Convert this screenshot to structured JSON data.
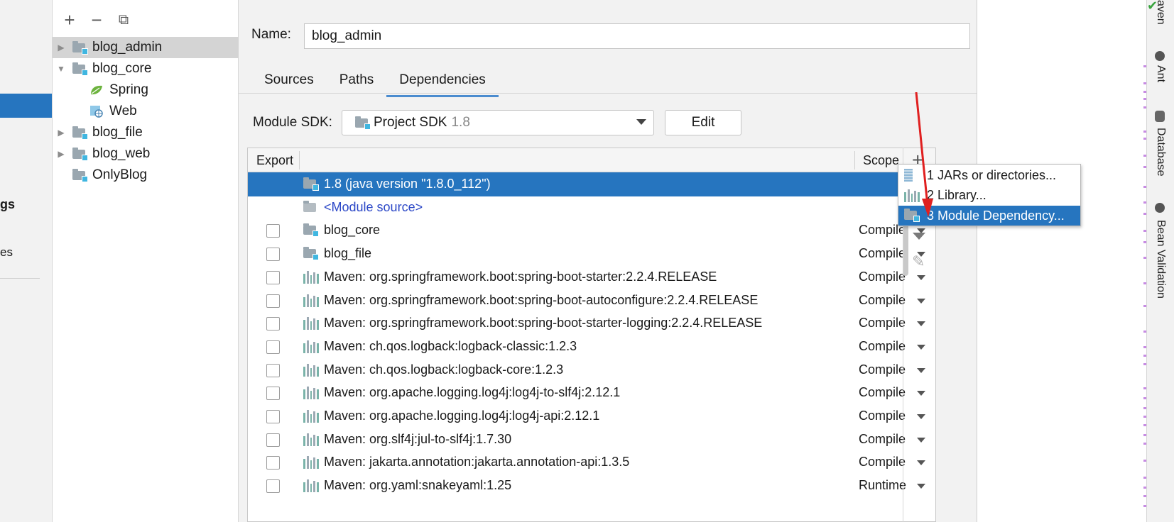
{
  "left_strip": {
    "partial_text_1": "gs",
    "partial_text_2": "es"
  },
  "tree": {
    "toolbar": {
      "add": "+",
      "remove": "−",
      "copy": "⧉"
    },
    "items": [
      {
        "label": "blog_admin",
        "expand": "collapsed",
        "selected": true,
        "icon": "module-folder-icon"
      },
      {
        "label": "blog_core",
        "expand": "expanded",
        "selected": false,
        "icon": "module-folder-icon"
      },
      {
        "label": "Spring",
        "expand": "none",
        "selected": false,
        "icon": "spring-leaf-icon"
      },
      {
        "label": "Web",
        "expand": "none",
        "selected": false,
        "icon": "web-icon"
      },
      {
        "label": "blog_file",
        "expand": "collapsed",
        "selected": false,
        "icon": "module-folder-icon"
      },
      {
        "label": "blog_web",
        "expand": "collapsed",
        "selected": false,
        "icon": "module-folder-icon"
      },
      {
        "label": "OnlyBlog",
        "expand": "none",
        "selected": false,
        "icon": "module-folder-icon"
      }
    ]
  },
  "main": {
    "name_label": "Name:",
    "name_value": "blog_admin",
    "tabs": [
      {
        "label": "Sources",
        "active": false
      },
      {
        "label": "Paths",
        "active": false
      },
      {
        "label": "Dependencies",
        "active": true
      }
    ],
    "sdk_label": "Module SDK:",
    "sdk_value": "Project SDK",
    "sdk_version": "1.8",
    "edit_button": "Edit"
  },
  "dependencies": {
    "header_export": "Export",
    "header_scope": "Scope",
    "rows": [
      {
        "label": "1.8 (java version \"1.8.0_112\")",
        "icon": "jdk-folder-icon",
        "checkbox": false,
        "scope": "",
        "selected": true
      },
      {
        "label": "<Module source>",
        "icon": "module-source-icon",
        "checkbox": false,
        "scope": "",
        "selected": false
      },
      {
        "label": "blog_core",
        "icon": "module-folder-icon",
        "checkbox": true,
        "scope": "Compile",
        "selected": false
      },
      {
        "label": "blog_file",
        "icon": "module-folder-icon",
        "checkbox": true,
        "scope": "Compile",
        "selected": false
      },
      {
        "label": "Maven: org.springframework.boot:spring-boot-starter:2.2.4.RELEASE",
        "icon": "library-icon",
        "checkbox": true,
        "scope": "Compile",
        "selected": false
      },
      {
        "label": "Maven: org.springframework.boot:spring-boot-autoconfigure:2.2.4.RELEASE",
        "icon": "library-icon",
        "checkbox": true,
        "scope": "Compile",
        "selected": false
      },
      {
        "label": "Maven: org.springframework.boot:spring-boot-starter-logging:2.2.4.RELEASE",
        "icon": "library-icon",
        "checkbox": true,
        "scope": "Compile",
        "selected": false
      },
      {
        "label": "Maven: ch.qos.logback:logback-classic:1.2.3",
        "icon": "library-icon",
        "checkbox": true,
        "scope": "Compile",
        "selected": false
      },
      {
        "label": "Maven: ch.qos.logback:logback-core:1.2.3",
        "icon": "library-icon",
        "checkbox": true,
        "scope": "Compile",
        "selected": false
      },
      {
        "label": "Maven: org.apache.logging.log4j:log4j-to-slf4j:2.12.1",
        "icon": "library-icon",
        "checkbox": true,
        "scope": "Compile",
        "selected": false
      },
      {
        "label": "Maven: org.apache.logging.log4j:log4j-api:2.12.1",
        "icon": "library-icon",
        "checkbox": true,
        "scope": "Compile",
        "selected": false
      },
      {
        "label": "Maven: org.slf4j:jul-to-slf4j:1.7.30",
        "icon": "library-icon",
        "checkbox": true,
        "scope": "Compile",
        "selected": false
      },
      {
        "label": "Maven: jakarta.annotation:jakarta.annotation-api:1.3.5",
        "icon": "library-icon",
        "checkbox": true,
        "scope": "Compile",
        "selected": false
      },
      {
        "label": "Maven: org.yaml:snakeyaml:1.25",
        "icon": "library-icon",
        "checkbox": true,
        "scope": "Runtime",
        "selected": false
      }
    ]
  },
  "table_tools": {
    "add": "+",
    "edit": "✎"
  },
  "popup_menu": {
    "items": [
      {
        "label": "1  JARs or directories...",
        "icon": "jar-icon",
        "selected": false
      },
      {
        "label": "2  Library...",
        "icon": "library-icon",
        "selected": false
      },
      {
        "label": "3  Module Dependency...",
        "icon": "module-folder-icon",
        "selected": true
      }
    ]
  },
  "right_strip": {
    "tool_windows": [
      "aven",
      "Ant",
      "Database",
      "Bean Validation"
    ]
  },
  "colors": {
    "selection": "#2675bf",
    "module_source": "#2c48c7",
    "annotation_arrow": "#e02020",
    "change_marker": "#c78be3"
  }
}
